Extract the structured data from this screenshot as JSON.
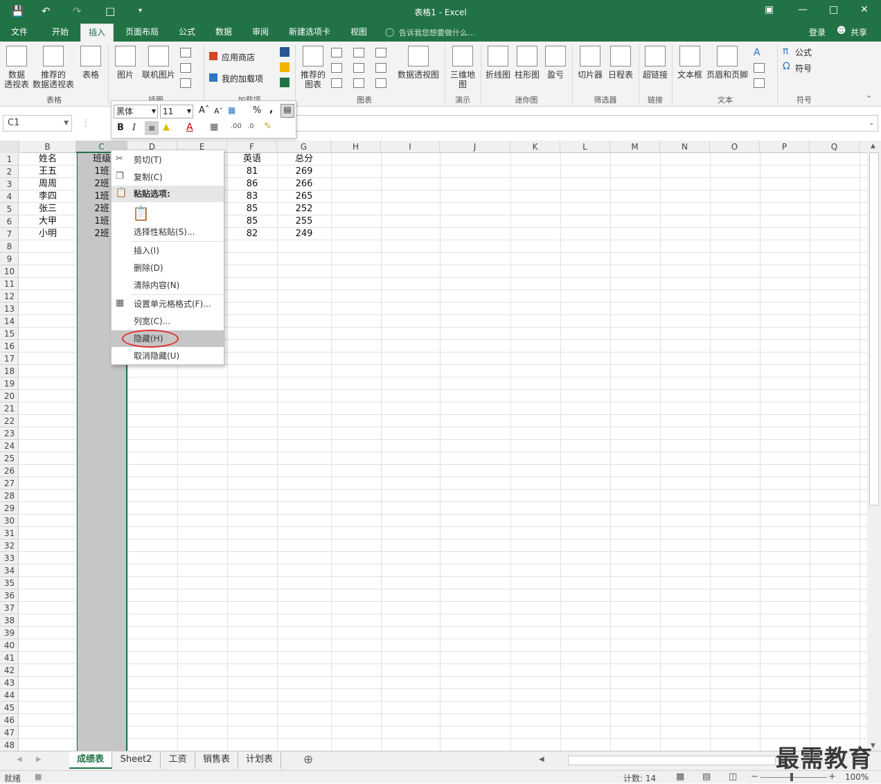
{
  "window": {
    "title": "表格1 - Excel"
  },
  "tabs": [
    "文件",
    "开始",
    "插入",
    "页面布局",
    "公式",
    "数据",
    "审阅",
    "新建选项卡",
    "视图"
  ],
  "active_tab": "插入",
  "tell_me": "告诉我您想要做什么...",
  "account": {
    "login": "登录",
    "share": "共享"
  },
  "ribbon": {
    "pivot": "数据\n透视表",
    "rec_pivot": "推荐的\n数据透视表",
    "table": "表格",
    "picture": "图片",
    "online_picture": "联机图片",
    "app_store": "应用商店",
    "my_addins": "我的加载项",
    "rec_charts": "推荐的\n图表",
    "pivot_chart": "数据透视图",
    "map3d": "三维地\n图",
    "line": "折线图",
    "column": "柱形图",
    "winloss": "盈亏",
    "slicer": "切片器",
    "timeline": "日程表",
    "hyperlink": "超链接",
    "textbox": "文本框",
    "header_footer": "页眉和页脚",
    "equation": "公式",
    "symbol": "符号",
    "groups": {
      "tables": "表格",
      "illustrations": "插图",
      "addins": "加载项",
      "charts": "图表",
      "tours": "演示",
      "sparklines": "迷你图",
      "filters": "筛选器",
      "links": "链接",
      "text": "文本",
      "symbols": "符号"
    }
  },
  "namebox": "C1",
  "minibar": {
    "font": "黑体",
    "size": "11",
    "percent": "%",
    "comma": ","
  },
  "columns": [
    "B",
    "C",
    "D",
    "E",
    "F",
    "G",
    "H",
    "I",
    "J",
    "K",
    "L",
    "M",
    "N",
    "O",
    "P",
    "Q"
  ],
  "rows": [
    "1",
    "2",
    "3",
    "4",
    "5",
    "6",
    "7",
    "8",
    "9",
    "10",
    "11",
    "12",
    "13",
    "14",
    "15",
    "16",
    "17",
    "18",
    "19",
    "20",
    "21",
    "22",
    "23",
    "24",
    "25",
    "26",
    "27",
    "28",
    "29",
    "30",
    "31",
    "32",
    "33",
    "34",
    "35",
    "36",
    "37",
    "38",
    "39",
    "40",
    "41",
    "42",
    "43",
    "44",
    "45",
    "46",
    "47",
    "48"
  ],
  "cells": {
    "B": [
      "姓名",
      "王五",
      "周周",
      "李四",
      "张三",
      "大甲",
      "小明"
    ],
    "C": [
      "班级",
      "1班",
      "2班",
      "1班",
      "2班",
      "1班",
      "2班"
    ],
    "F": [
      "英语",
      "81",
      "86",
      "83",
      "85",
      "85",
      "82"
    ],
    "G": [
      "总分",
      "269",
      "266",
      "265",
      "252",
      "255",
      "249"
    ]
  },
  "context_menu": {
    "cut": "剪切(T)",
    "copy": "复制(C)",
    "paste_options": "粘贴选项:",
    "paste_special": "选择性粘贴(S)...",
    "insert": "插入(I)",
    "delete": "删除(D)",
    "clear": "清除内容(N)",
    "format_cells": "设置单元格格式(F)...",
    "col_width": "列宽(C)...",
    "hide": "隐藏(H)",
    "unhide": "取消隐藏(U)"
  },
  "sheets": [
    "成绩表",
    "Sheet2",
    "工资",
    "销售表",
    "计划表"
  ],
  "active_sheet": "成绩表",
  "status": {
    "ready": "就绪",
    "count": "计数: 14",
    "zoom": "100%"
  },
  "watermark": "最需教育",
  "colors": {
    "accent": "#217346",
    "highlight": "#e0302e"
  }
}
